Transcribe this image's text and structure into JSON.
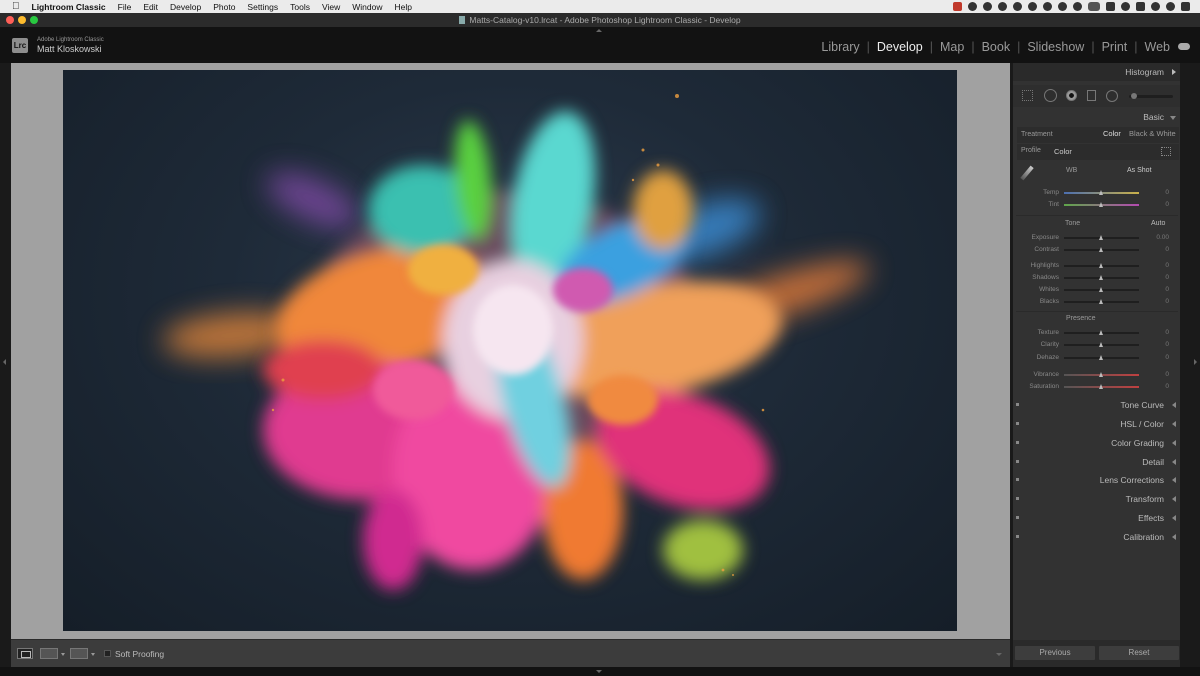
{
  "menubar": {
    "app_name": "Lightroom Classic",
    "items": [
      "File",
      "Edit",
      "Develop",
      "Photo",
      "Settings",
      "Tools",
      "View",
      "Window",
      "Help"
    ]
  },
  "window": {
    "title": "Matts-Catalog-v10.lrcat - Adobe Photoshop Lightroom Classic - Develop"
  },
  "identity": {
    "logo": "Lrc",
    "app_name": "Adobe Lightroom Classic",
    "user_name": "Matt Kloskowski"
  },
  "modules": {
    "items": [
      "Library",
      "Develop",
      "Map",
      "Book",
      "Slideshow",
      "Print",
      "Web"
    ],
    "active": "Develop"
  },
  "toolbar": {
    "soft_proofing_label": "Soft Proofing"
  },
  "right_panel": {
    "histogram_label": "Histogram",
    "basic_label": "Basic",
    "treatment_label": "Treatment",
    "treatment_color": "Color",
    "treatment_bw": "Black & White",
    "profile_label": "Profile",
    "profile_value": "Color",
    "wb_label": "WB",
    "wb_value": "As Shot",
    "tone_label": "Tone",
    "tone_auto": "Auto",
    "presence_label": "Presence",
    "sliders": {
      "temp": {
        "name": "Temp",
        "value": "0",
        "pos": 0.5
      },
      "tint": {
        "name": "Tint",
        "value": "0",
        "pos": 0.5
      },
      "exposure": {
        "name": "Exposure",
        "value": "0.00",
        "pos": 0.5
      },
      "contrast": {
        "name": "Contrast",
        "value": "0",
        "pos": 0.5
      },
      "highlights": {
        "name": "Highlights",
        "value": "0",
        "pos": 0.5
      },
      "shadows": {
        "name": "Shadows",
        "value": "0",
        "pos": 0.5
      },
      "whites": {
        "name": "Whites",
        "value": "0",
        "pos": 0.5
      },
      "blacks": {
        "name": "Blacks",
        "value": "0",
        "pos": 0.5
      },
      "texture": {
        "name": "Texture",
        "value": "0",
        "pos": 0.5
      },
      "clarity": {
        "name": "Clarity",
        "value": "0",
        "pos": 0.5
      },
      "dehaze": {
        "name": "Dehaze",
        "value": "0",
        "pos": 0.5
      },
      "vibrance": {
        "name": "Vibrance",
        "value": "0",
        "pos": 0.5
      },
      "saturation": {
        "name": "Saturation",
        "value": "0",
        "pos": 0.5
      }
    },
    "collapsed_panels": {
      "tone_curve": "Tone Curve",
      "hsl": "HSL / Color",
      "color_grading": "Color Grading",
      "detail": "Detail",
      "lens_corrections": "Lens Corrections",
      "transform": "Transform",
      "effects": "Effects",
      "calibration": "Calibration"
    },
    "previous_button": "Previous",
    "reset_button": "Reset"
  },
  "colors": {
    "background": "#1a1a1a",
    "panel": "#323232",
    "image_backdrop": "#a1a1a1",
    "photo_bg": "#1e2a38"
  }
}
